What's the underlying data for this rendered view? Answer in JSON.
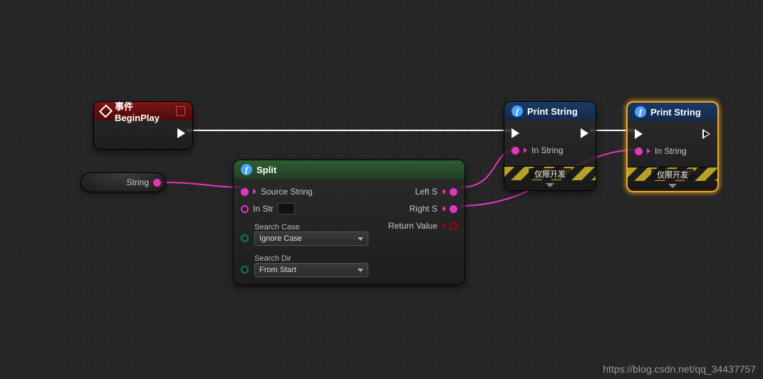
{
  "watermark": "https://blog.csdn.net/qq_34437757",
  "nodes": {
    "event": {
      "title": "事件BeginPlay"
    },
    "variable": {
      "name": "String"
    },
    "split": {
      "title": "Split",
      "pins": {
        "source": "Source String",
        "instr": "In Str",
        "searchCase": "Search Case",
        "searchDir": "Search Dir",
        "leftS": "Left S",
        "rightS": "Right S",
        "returnValue": "Return Value"
      },
      "searchCaseValue": "Ignore Case",
      "searchDirValue": "From Start"
    },
    "print1": {
      "title": "Print String",
      "inString": "In String",
      "devOnly": "仅限开发"
    },
    "print2": {
      "title": "Print String",
      "inString": "In String",
      "devOnly": "仅限开发"
    }
  }
}
